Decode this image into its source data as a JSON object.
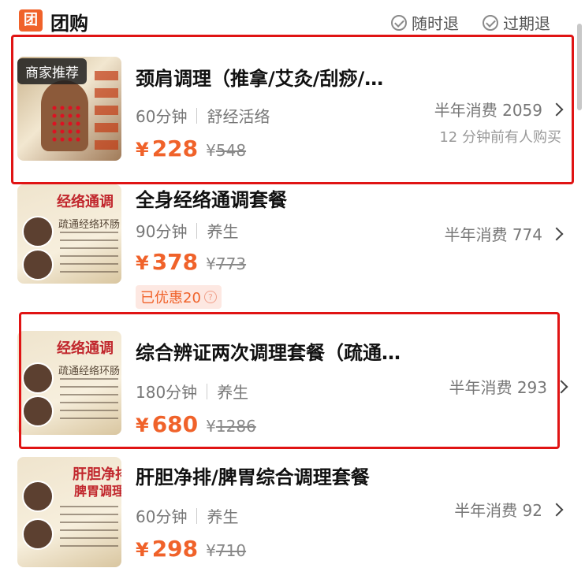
{
  "header": {
    "logo_char": "团",
    "title": "团购",
    "tags": [
      "随时退",
      "过期退"
    ]
  },
  "cards": [
    {
      "badge": "商家推荐",
      "name": "颈肩调理（推拿/艾灸/刮痧/…",
      "duration": "60分钟",
      "category": "舒经活络",
      "currency": "¥",
      "price": "228",
      "original_price": "548",
      "sales": "半年消费 2059",
      "recent": "12 分钟前有人购买"
    },
    {
      "name": "全身经络通调套餐",
      "duration": "90分钟",
      "category": "养生",
      "currency": "¥",
      "price": "378",
      "original_price": "773",
      "sales": "半年消费 774",
      "discount": "已优惠20",
      "thumb_title": "经络通调",
      "thumb_sub": "疏通经络环肠"
    },
    {
      "name": "综合辨证两次调理套餐（疏通…",
      "duration": "180分钟",
      "category": "养生",
      "currency": "¥",
      "price": "680",
      "original_price": "1286",
      "sales": "半年消费 293",
      "thumb_title": "经络通调",
      "thumb_sub": "疏通经络环肠"
    },
    {
      "name": "肝胆净排/脾胃综合调理套餐",
      "duration": "60分钟",
      "category": "养生",
      "currency": "¥",
      "price": "298",
      "original_price": "710",
      "sales": "半年消费 92",
      "thumb_title": "肝胆净排",
      "thumb_sub": "脾胃调理"
    }
  ],
  "colors": {
    "accent": "#f0622a",
    "highlight": "#e01414"
  }
}
